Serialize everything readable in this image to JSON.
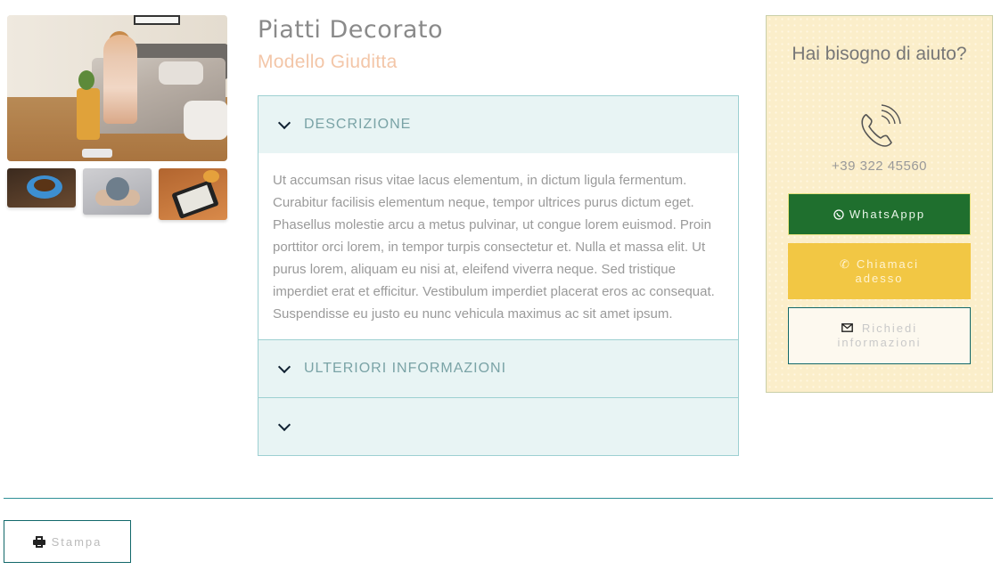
{
  "product": {
    "title": "Piatti Decorato",
    "subtitle": "Modello Giuditta"
  },
  "gallery": {
    "main_image": "bedroom-woman-scale-photo",
    "thumbnails": [
      "coffee-cup-photo",
      "hands-ball-photo",
      "ereader-donuts-photo"
    ]
  },
  "accordion": {
    "sections": [
      {
        "label": "DESCRIZIONE",
        "expanded": true
      },
      {
        "label": "ULTERIORI INFORMAZIONI",
        "expanded": false
      },
      {
        "label": "",
        "expanded": false
      }
    ],
    "description_text": "Ut accumsan risus vitae lacus elementum, in dictum ligula fermentum. Curabitur facilisis elementum neque, tempor ultrices purus dictum eget. Phasellus molestie arcu a metus pulvinar, ut congue lorem euismod. Proin porttitor orci lorem, in tempor turpis consectetur et. Nulla et massa elit. Ut purus lorem, aliquam eu nisi at, eleifend viverra neque. Sed tristique imperdiet erat et efficitur. Vestibulum imperdiet placerat eros ac consequat. Suspendisse eu justo eu nunc vehicula maximus ac sit amet ipsum."
  },
  "help": {
    "title": "Hai bisogno di aiuto?",
    "phone": "+39 322 45560",
    "whatsapp_label": "WhatsAppp",
    "call_label": "Chiamaci adesso",
    "info_label": "Richiedi informazioni",
    "colors": {
      "panel_bg": "#fbeeca",
      "whatsapp": "#1f6f2e",
      "call": "#f2c744",
      "accent": "#12686a"
    }
  },
  "footer": {
    "print_label": "Stampa"
  }
}
